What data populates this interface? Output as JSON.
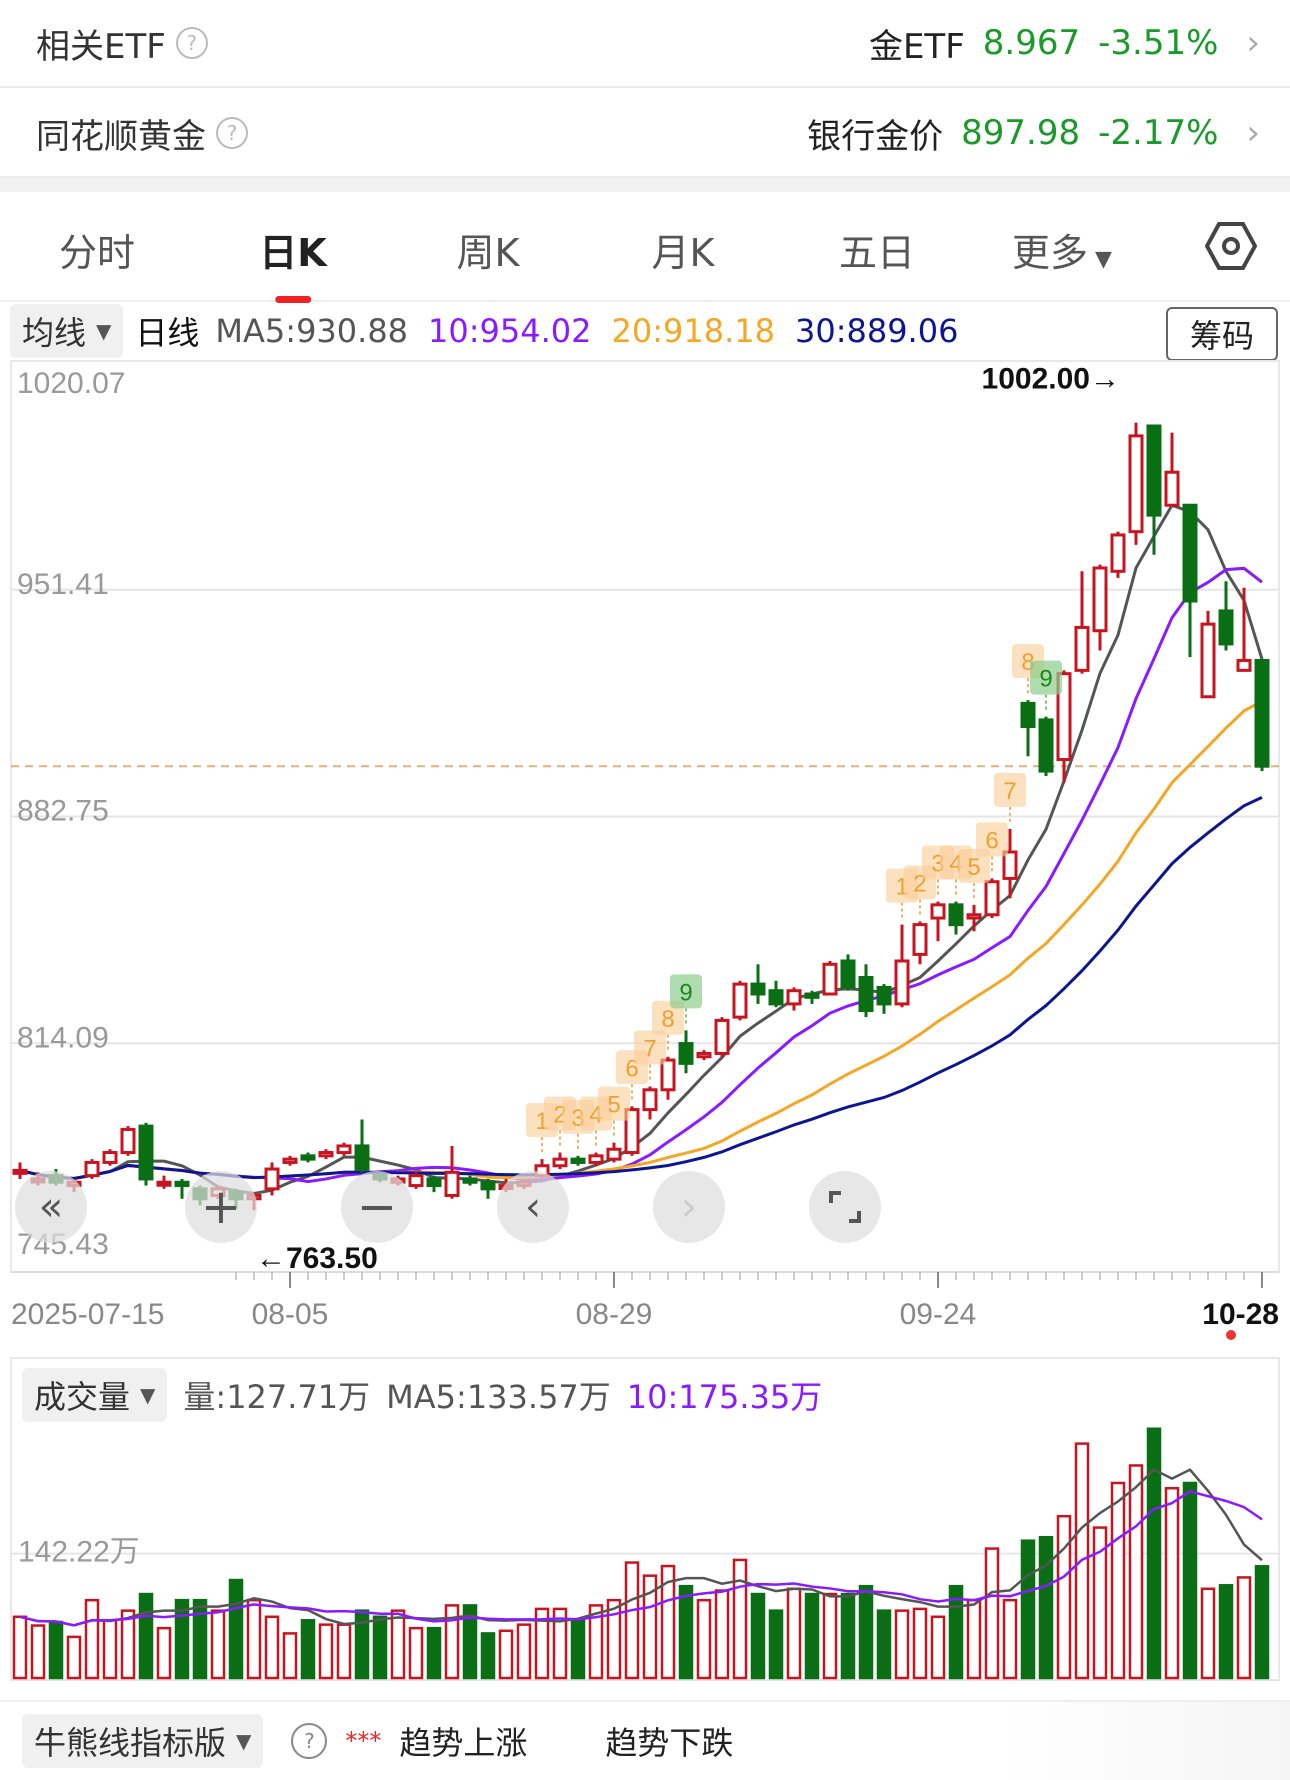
{
  "related": [
    {
      "label": "相关ETF",
      "name": "金ETF",
      "price": "8.967",
      "change": "-3.51%"
    },
    {
      "label": "同花顺黄金",
      "name": "银行金价",
      "price": "897.98",
      "change": "-2.17%"
    }
  ],
  "tabs": [
    {
      "label": "分时"
    },
    {
      "label": "日K",
      "active": true
    },
    {
      "label": "周K"
    },
    {
      "label": "月K"
    },
    {
      "label": "五日"
    },
    {
      "label": "更多"
    }
  ],
  "ma_row": {
    "selector": "均线",
    "period": "日线",
    "ma5": "MA5:930.88",
    "ma10": "10:954.02",
    "ma20": "20:918.18",
    "ma30": "30:889.06",
    "chip_button": "筹码"
  },
  "colors": {
    "up": "#c8141e",
    "down": "#0a6e14",
    "ma5": "#555555",
    "ma10": "#8a1aff",
    "ma20": "#f5a623",
    "ma30": "#0d1690",
    "text_green": "#1a9a2a"
  },
  "chart_data": {
    "type": "candlestick",
    "price_axis": [
      "1020.07",
      "951.41",
      "882.75",
      "814.09",
      "745.43"
    ],
    "ylim": [
      745.43,
      1020.07
    ],
    "x_labels": [
      {
        "i": 0,
        "label": "2025-07-15"
      },
      {
        "i": 15,
        "label": "08-05"
      },
      {
        "i": 33,
        "label": "08-29"
      },
      {
        "i": 51,
        "label": "09-24"
      },
      {
        "i": 69,
        "label": "10-28"
      }
    ],
    "max_label": "1002.00→",
    "min_label": "←763.50",
    "max_index": 62,
    "min_index": 13,
    "last_close": 897.98,
    "ohlc": [
      [
        775,
        778,
        773,
        775.6
      ],
      [
        773,
        775,
        771,
        773
      ],
      [
        774,
        776,
        771,
        772
      ],
      [
        771,
        773,
        769,
        772
      ],
      [
        774,
        779,
        773,
        778
      ],
      [
        778,
        782,
        777,
        781
      ],
      [
        781,
        789,
        780,
        788
      ],
      [
        789,
        790,
        771,
        773
      ],
      [
        772,
        774,
        770,
        772
      ],
      [
        772,
        773,
        767,
        771
      ],
      [
        770,
        771,
        765,
        767
      ],
      [
        768,
        771,
        767,
        770
      ],
      [
        769,
        770,
        764,
        767
      ],
      [
        767,
        769,
        763.5,
        768
      ],
      [
        770,
        778,
        768,
        776
      ],
      [
        778,
        780,
        777,
        779
      ],
      [
        780,
        781,
        778,
        779
      ],
      [
        780,
        782,
        779,
        781
      ],
      [
        781,
        784,
        780,
        783
      ],
      [
        783,
        791,
        775,
        776
      ],
      [
        774,
        775,
        772,
        773
      ],
      [
        772,
        774,
        771,
        773
      ],
      [
        771,
        775,
        770,
        774
      ],
      [
        773,
        774,
        769,
        771
      ],
      [
        768,
        783,
        767,
        775
      ],
      [
        773,
        774,
        771,
        772
      ],
      [
        772,
        773,
        767,
        770
      ],
      [
        771,
        773,
        769,
        771
      ],
      [
        771,
        773,
        770,
        772
      ],
      [
        774,
        779,
        773,
        777
      ],
      [
        777,
        781,
        776,
        779
      ],
      [
        779,
        780,
        777,
        778
      ],
      [
        778,
        781,
        777,
        780
      ],
      [
        779,
        784,
        778,
        782
      ],
      [
        781,
        795,
        780,
        794
      ],
      [
        794,
        801,
        791,
        800
      ],
      [
        800,
        810,
        797,
        809
      ],
      [
        814,
        818,
        805,
        808
      ],
      [
        810,
        812,
        809,
        811
      ],
      [
        811,
        822,
        810,
        821
      ],
      [
        822,
        833,
        821,
        832
      ],
      [
        832,
        838,
        826,
        829
      ],
      [
        830,
        833,
        825,
        826
      ],
      [
        826,
        831,
        824,
        830
      ],
      [
        829,
        830,
        826,
        828
      ],
      [
        829,
        839,
        829,
        838
      ],
      [
        839,
        841,
        830,
        831
      ],
      [
        834,
        838,
        822,
        824
      ],
      [
        831,
        832,
        823,
        826
      ],
      [
        826,
        850,
        825,
        839
      ],
      [
        841,
        851,
        838,
        850
      ],
      [
        852,
        857,
        845,
        856
      ],
      [
        856,
        857,
        847,
        850
      ],
      [
        852,
        856,
        848,
        853
      ],
      [
        853,
        864,
        852,
        863
      ],
      [
        864,
        879,
        858,
        872
      ],
      [
        917,
        918,
        901,
        910
      ],
      [
        912,
        913,
        895,
        896.5
      ],
      [
        900,
        927,
        893,
        926
      ],
      [
        927,
        957,
        926,
        940
      ],
      [
        939,
        959,
        933,
        958
      ],
      [
        957,
        969,
        955,
        968
      ],
      [
        969,
        1002,
        965,
        998
      ],
      [
        1001,
        1001,
        962,
        974
      ],
      [
        977,
        999,
        977,
        987
      ],
      [
        977,
        977,
        931,
        948
      ],
      [
        919,
        945,
        919,
        941
      ],
      [
        945,
        954,
        933,
        935
      ],
      [
        927,
        952,
        927,
        930
      ],
      [
        930,
        930,
        896.5,
        897.98
      ]
    ],
    "td_labels": [
      [
        29,
        "1"
      ],
      [
        30,
        "2"
      ],
      [
        31,
        "3"
      ],
      [
        32,
        "4"
      ],
      [
        33,
        "5"
      ],
      [
        34,
        "6"
      ],
      [
        35,
        "7"
      ],
      [
        36,
        "8"
      ],
      [
        37,
        "9"
      ],
      [
        49,
        "1"
      ],
      [
        50,
        "2"
      ],
      [
        51,
        "3"
      ],
      [
        52,
        "4"
      ],
      [
        53,
        "5"
      ],
      [
        54,
        "6"
      ],
      [
        55,
        "7"
      ],
      [
        56,
        "8"
      ],
      [
        57,
        "9"
      ]
    ],
    "volume": {
      "axis_label": "142.22万",
      "axis_value": 142.22,
      "max": 295,
      "values": [
        70,
        60,
        64,
        47,
        89,
        66,
        77,
        96,
        57,
        89,
        89,
        77,
        112,
        89,
        70,
        51,
        66,
        61,
        61,
        77,
        70,
        77,
        57,
        57,
        83,
        83,
        51,
        54,
        61,
        79,
        79,
        66,
        83,
        89,
        132,
        117,
        128,
        105,
        89,
        100,
        135,
        96,
        77,
        102,
        96,
        96,
        96,
        105,
        77,
        77,
        79,
        70,
        105,
        89,
        148,
        89,
        157,
        161,
        185,
        268,
        172,
        223,
        243,
        285,
        217,
        223,
        102,
        106,
        115,
        127.71
      ]
    }
  },
  "volume_header": {
    "selector": "成交量",
    "vol": "量:127.71万",
    "ma5": "MA5:133.57万",
    "ma10": "10:175.35万"
  },
  "bottom": {
    "selector": "牛熊线指标版",
    "stars": "***",
    "up_text": "趋势上涨",
    "down_text": "趋势下跌"
  }
}
